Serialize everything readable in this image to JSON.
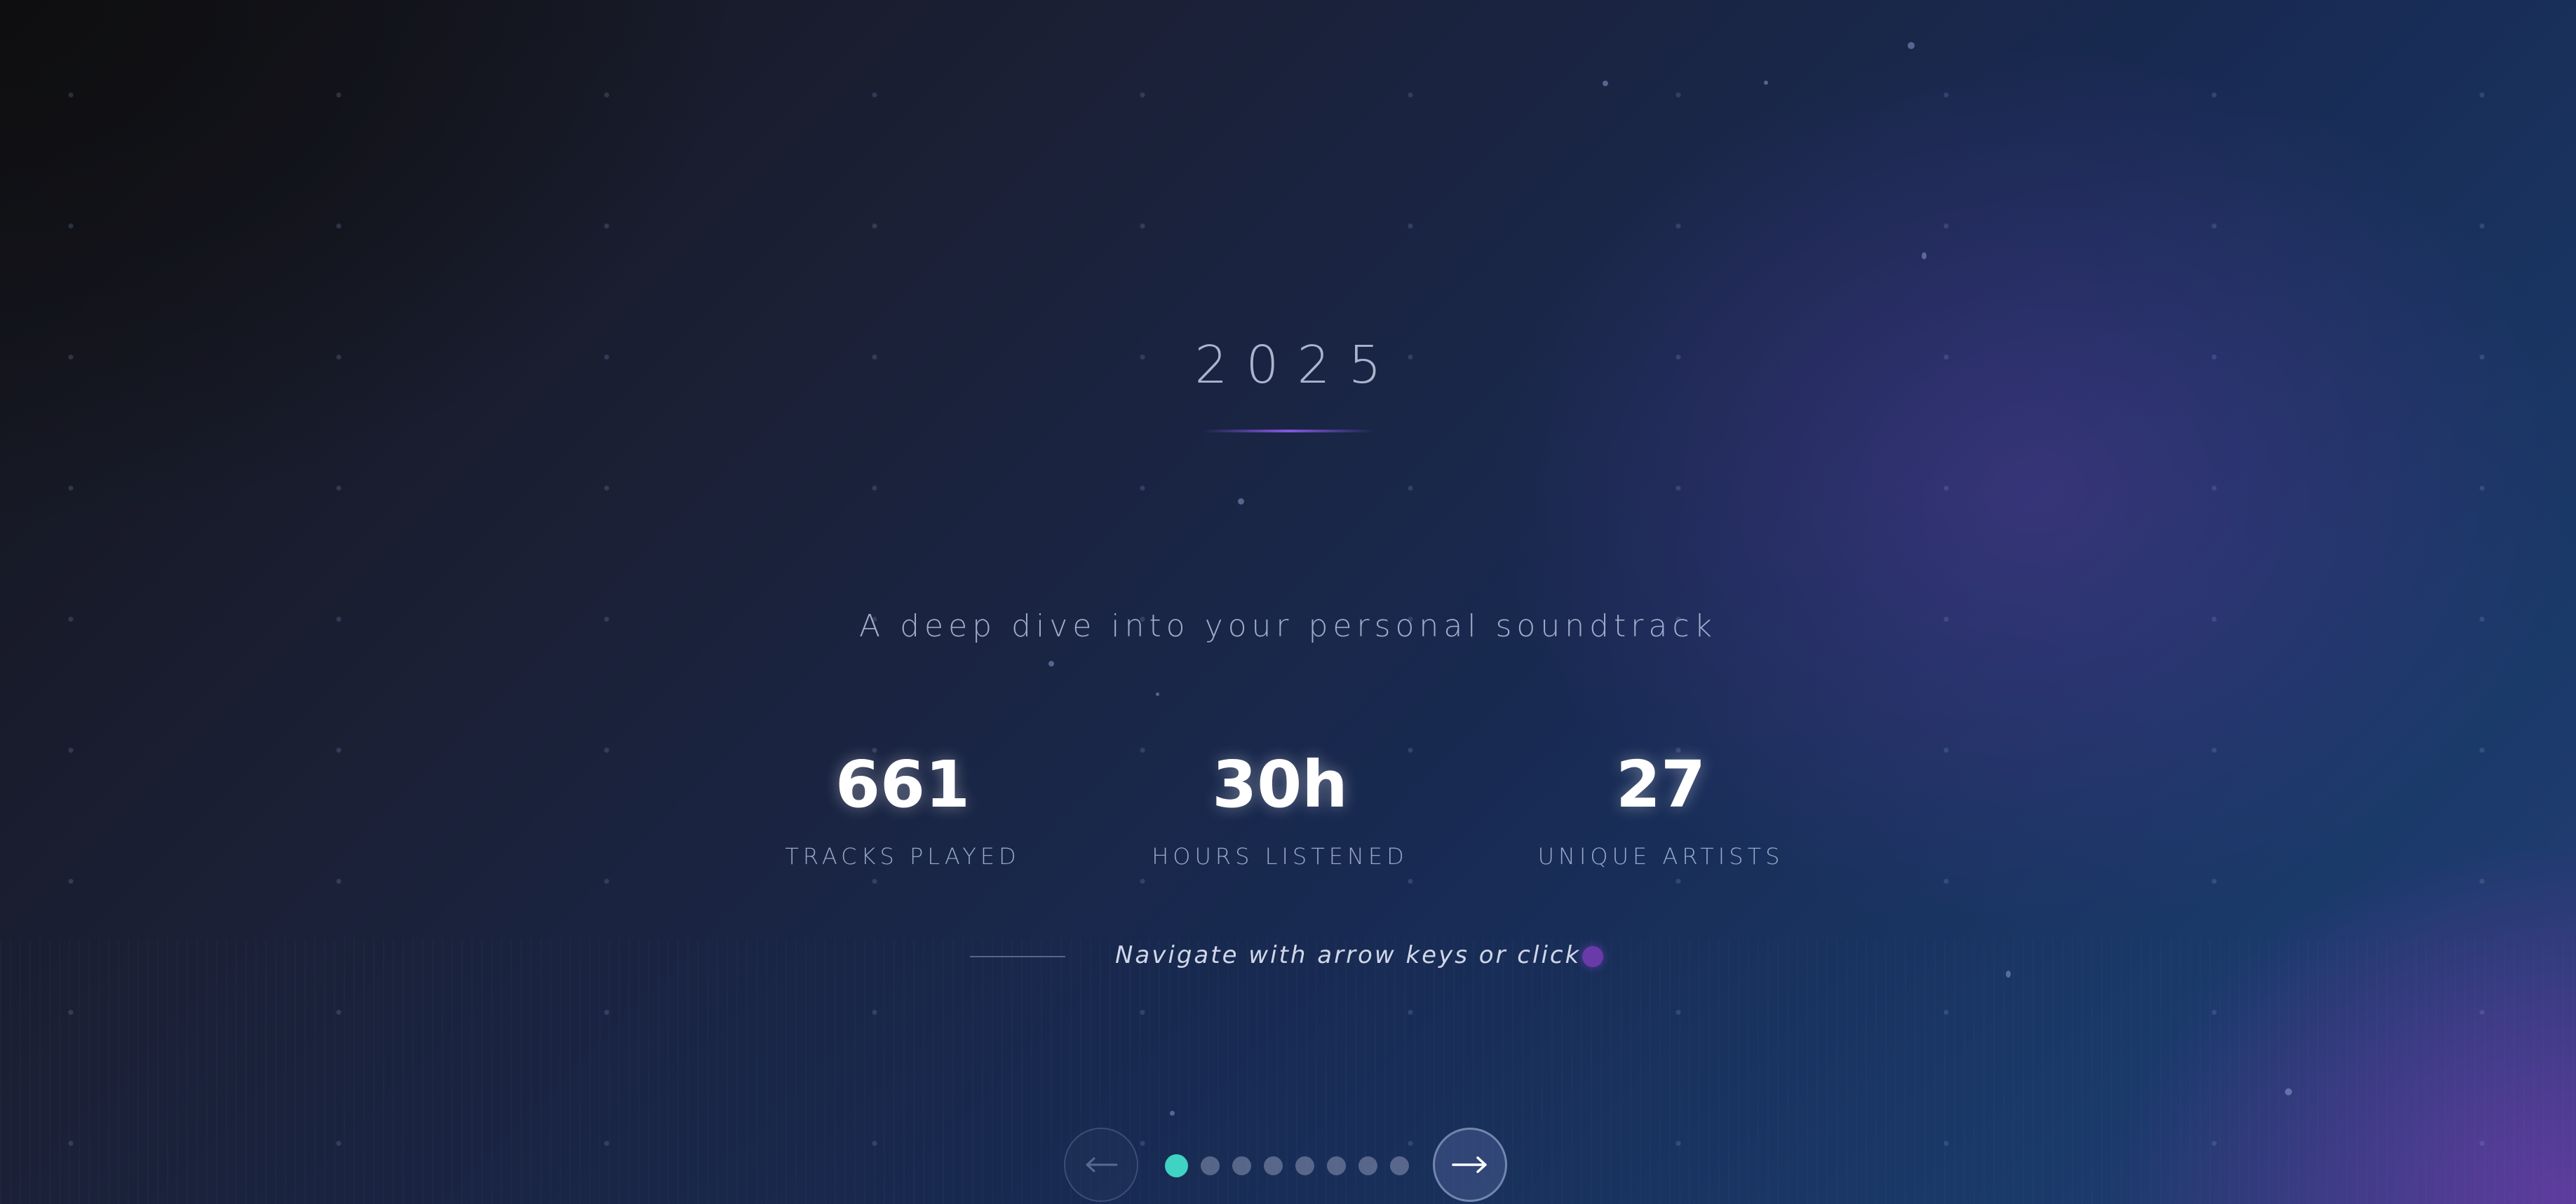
{
  "hero": {
    "year": "2025",
    "subtitle": "A deep dive into your personal soundtrack"
  },
  "stats": [
    {
      "value": "661",
      "label": "TRACKS PLAYED"
    },
    {
      "value": "30h",
      "label": "HOURS LISTENED"
    },
    {
      "value": "27",
      "label": "UNIQUE ARTISTS"
    }
  ],
  "hint": {
    "text": "Navigate with arrow keys or click"
  },
  "navigation": {
    "prev_icon": "arrow-left-icon",
    "next_icon": "arrow-right-icon",
    "slide_count": 8,
    "active_index": 0
  },
  "colors": {
    "accent_teal": "#3fd3c4",
    "accent_purple": "#6a3aa8"
  }
}
